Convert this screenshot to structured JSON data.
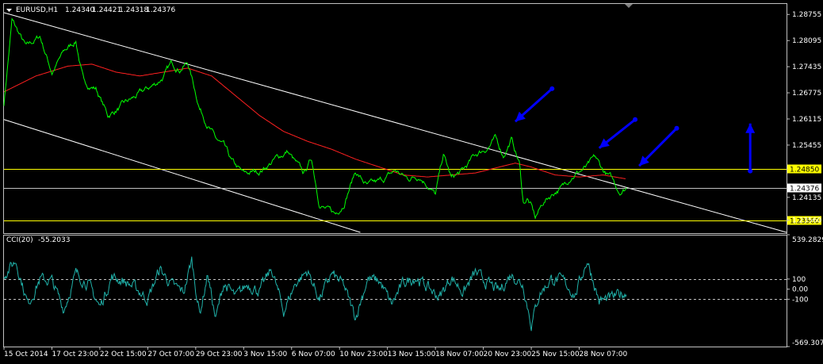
{
  "chart_data": {
    "type": "line",
    "symbol": "EURUSD,H1",
    "ohlc": [
      "1.24340",
      "1.24421",
      "1.24318",
      "1.24376"
    ],
    "colors": {
      "background": "#000000",
      "frame": "#c0c0c0",
      "price": "#00ff00",
      "ma": "#ff2020",
      "channel": "#ffffff",
      "levels": "#ffff00",
      "arrows": "#0000ff",
      "cci": "#20b2aa"
    },
    "price_axis": {
      "ylim": [
        1.2325,
        1.29
      ],
      "ticks": [
        "1.28755",
        "1.28095",
        "1.27435",
        "1.26775",
        "1.26115",
        "1.25455",
        "1.24135",
        "1.23560"
      ]
    },
    "x_labels": [
      "15 Oct 2014",
      "17 Oct 23:00",
      "22 Oct 15:00",
      "27 Oct 07:00",
      "29 Oct 23:00",
      "3 Nov 15:00",
      "6 Nov 07:00",
      "10 Nov 23:00",
      "13 Nov 15:00",
      "18 Nov 07:00",
      "20 Nov 23:00",
      "25 Nov 15:00",
      "28 Nov 07:00"
    ],
    "n_bars": 780,
    "price_series": {
      "name": "EURUSD",
      "x": [
        0,
        10,
        28,
        45,
        60,
        75,
        90,
        100,
        115,
        130,
        145,
        160,
        175,
        190,
        200,
        210,
        220,
        230,
        245,
        255,
        265,
        275,
        285,
        300,
        320,
        340,
        355,
        365,
        375,
        385,
        395,
        405,
        415,
        425,
        440,
        455,
        470,
        490,
        505,
        520,
        530,
        540,
        550,
        560,
        575,
        590,
        605,
        615,
        625,
        635,
        645,
        650,
        655,
        660,
        665,
        675,
        690,
        700,
        710,
        720,
        730,
        740,
        750,
        760,
        770,
        779
      ],
      "y": [
        1.265,
        1.286,
        1.279,
        1.282,
        1.273,
        1.278,
        1.281,
        1.27,
        1.269,
        1.262,
        1.264,
        1.266,
        1.268,
        1.27,
        1.272,
        1.275,
        1.274,
        1.2755,
        1.264,
        1.26,
        1.256,
        1.254,
        1.25,
        1.247,
        1.248,
        1.251,
        1.253,
        1.25,
        1.247,
        1.251,
        1.24,
        1.238,
        1.237,
        1.24,
        1.248,
        1.244,
        1.245,
        1.248,
        1.246,
        1.247,
        1.245,
        1.242,
        1.252,
        1.246,
        1.248,
        1.252,
        1.254,
        1.256,
        1.252,
        1.256,
        1.25,
        1.24,
        1.241,
        1.239,
        1.236,
        1.24,
        1.243,
        1.244,
        1.247,
        1.248,
        1.249,
        1.251,
        1.248,
        1.246,
        1.243,
        1.2438
      ]
    },
    "ma_series": {
      "x": [
        0,
        40,
        80,
        110,
        140,
        170,
        200,
        230,
        260,
        290,
        320,
        350,
        380,
        410,
        440,
        470,
        500,
        530,
        560,
        590,
        610,
        640,
        660,
        690,
        720,
        750,
        779
      ],
      "y": [
        1.268,
        1.272,
        1.2745,
        1.275,
        1.273,
        1.272,
        1.273,
        1.274,
        1.272,
        1.267,
        1.262,
        1.258,
        1.2555,
        1.2535,
        1.251,
        1.249,
        1.247,
        1.2465,
        1.247,
        1.2475,
        1.2485,
        1.25,
        1.249,
        1.247,
        1.2465,
        1.247,
        1.246
      ]
    },
    "channel": {
      "upper": {
        "x": [
          0,
          1000
        ],
        "y": [
          1.288,
          1.2308
        ]
      },
      "lower": {
        "x": [
          0,
          446
        ],
        "y": [
          1.261,
          1.2325
        ]
      }
    },
    "levels": [
      {
        "value": 1.2485,
        "label": "1.24850",
        "color": "#ffff00"
      },
      {
        "value": 1.24376,
        "label": "1.24376",
        "color": "#c0c0c0"
      },
      {
        "value": 1.2356,
        "label": "1.23560",
        "color": "#ffff00"
      }
    ],
    "arrows": [
      {
        "from": {
          "x": 686,
          "y": 1.2688
        },
        "to": {
          "x": 640,
          "y": 1.2605
        }
      },
      {
        "from": {
          "x": 790,
          "y": 1.261
        },
        "to": {
          "x": 745,
          "y": 1.2538
        }
      },
      {
        "from": {
          "x": 842,
          "y": 1.2588
        },
        "to": {
          "x": 795,
          "y": 1.2493
        }
      },
      {
        "from": {
          "x": 934,
          "y": 1.248
        },
        "to": {
          "x": 934,
          "y": 1.26
        }
      }
    ],
    "cci": {
      "label": "CCI(20)",
      "value": "-55.2033",
      "ylim": [
        -569.3071,
        539.2829
      ],
      "ticks": [
        "539.2829",
        "100",
        "0.00",
        "-100",
        "-569.3071"
      ],
      "levels": [
        100,
        -100
      ],
      "x": [
        0,
        15,
        30,
        45,
        60,
        75,
        90,
        105,
        120,
        135,
        150,
        165,
        180,
        195,
        210,
        225,
        235,
        245,
        255,
        265,
        275,
        290,
        305,
        320,
        335,
        350,
        365,
        380,
        395,
        410,
        425,
        440,
        455,
        470,
        485,
        500,
        515,
        530,
        545,
        560,
        575,
        590,
        605,
        620,
        635,
        650,
        660,
        670,
        685,
        700,
        715,
        730,
        745,
        760,
        775,
        779
      ],
      "y": [
        150,
        280,
        -150,
        100,
        80,
        -200,
        150,
        60,
        -180,
        120,
        80,
        10,
        -100,
        200,
        40,
        -30,
        290,
        -250,
        150,
        -300,
        60,
        -80,
        50,
        -20,
        200,
        -220,
        60,
        180,
        -100,
        150,
        40,
        -280,
        100,
        80,
        -150,
        60,
        120,
        20,
        -80,
        120,
        -30,
        160,
        60,
        -20,
        150,
        40,
        -350,
        -50,
        100,
        80,
        -60,
        290,
        -120,
        -90,
        -40,
        -55
      ]
    }
  }
}
